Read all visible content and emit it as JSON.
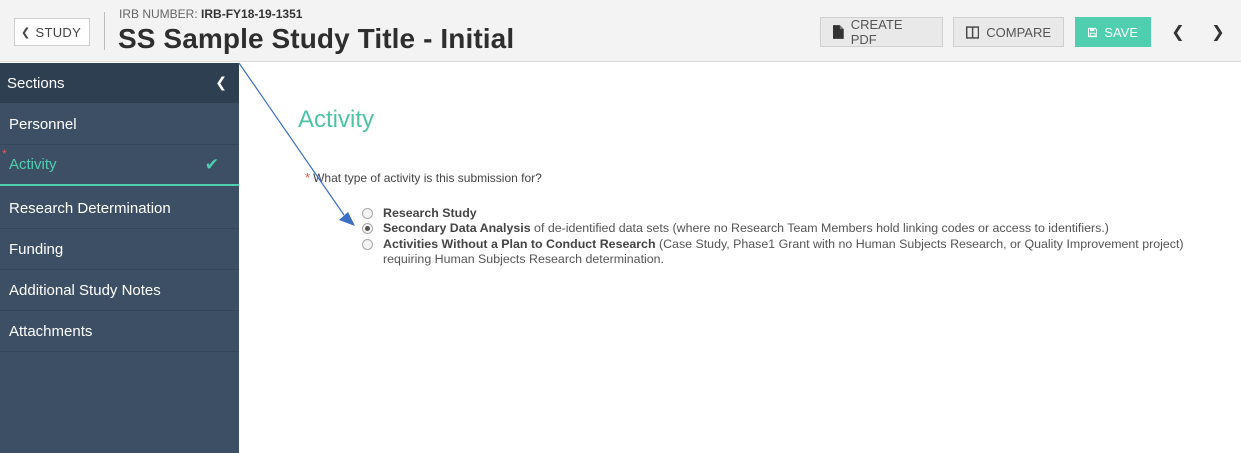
{
  "header": {
    "back_label": "STUDY",
    "irb_label": "IRB NUMBER:",
    "irb_number": "IRB-FY18-19-1351",
    "title": "SS Sample Study Title - Initial",
    "create_pdf": "CREATE PDF",
    "compare": "COMPARE",
    "save": "SAVE"
  },
  "sidebar": {
    "header": "Sections",
    "items": [
      {
        "label": "Personnel"
      },
      {
        "label": "Activity",
        "active": true,
        "complete": true
      },
      {
        "label": "Research Determination"
      },
      {
        "label": "Funding"
      },
      {
        "label": "Additional Study Notes"
      },
      {
        "label": "Attachments"
      }
    ]
  },
  "main": {
    "title": "Activity",
    "question": "What type of activity is this submission for?",
    "options": [
      {
        "bold": "Research Study",
        "rest": "",
        "selected": false
      },
      {
        "bold": "Secondary Data Analysis",
        "rest": " of de-identified data sets (where no Research Team Members hold linking codes or access to identifiers.)",
        "selected": true
      },
      {
        "bold": "Activities Without a Plan to Conduct Research",
        "rest": " (Case Study, Phase1 Grant with no Human Subjects Research, or Quality Improvement project) requiring Human Subjects Research determination.",
        "selected": false
      }
    ]
  },
  "colors": {
    "accent": "#4fcfb0",
    "sidebar_bg": "#3d4f64",
    "sidebar_header_bg": "#2f3f52",
    "required": "#e05555",
    "arrow": "#3a6fc4"
  }
}
